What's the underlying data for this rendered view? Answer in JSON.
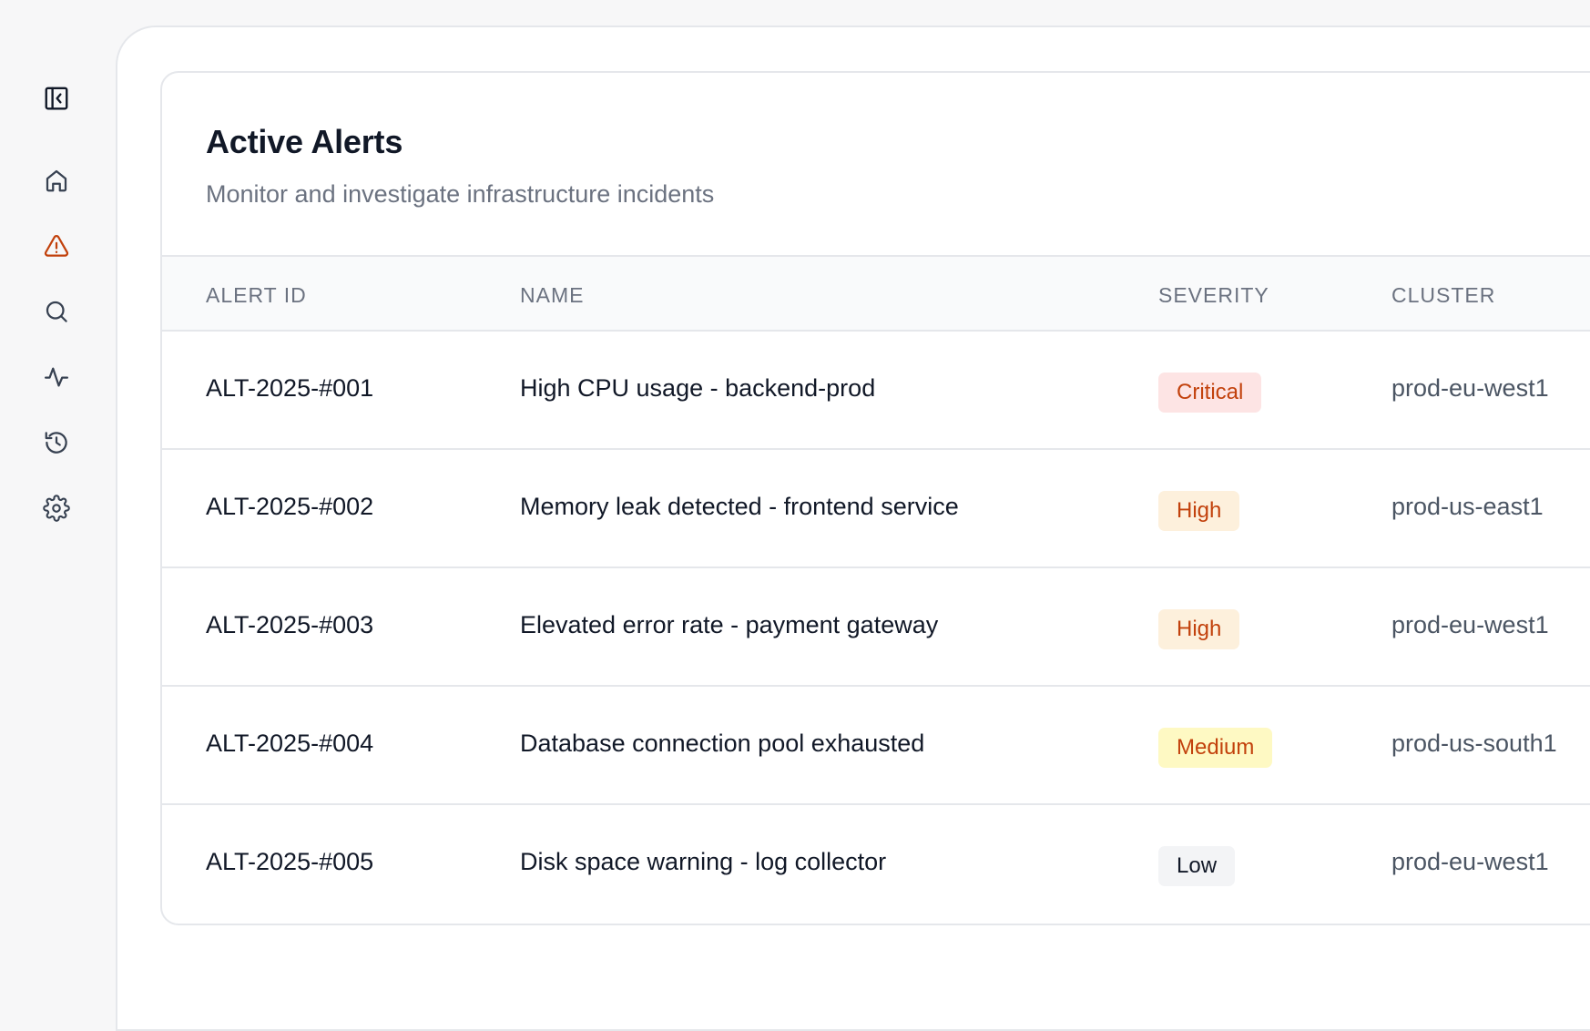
{
  "sidebar": {
    "items": [
      {
        "icon": "collapse-sidebar-icon",
        "active": false
      },
      {
        "icon": "home-icon",
        "active": false
      },
      {
        "icon": "alert-triangle-icon",
        "active": true
      },
      {
        "icon": "search-icon",
        "active": false
      },
      {
        "icon": "activity-icon",
        "active": false
      },
      {
        "icon": "history-icon",
        "active": false
      },
      {
        "icon": "settings-icon",
        "active": false
      }
    ],
    "icon_color": "#374151",
    "active_color": "#c2410c"
  },
  "alerts_panel": {
    "title": "Active Alerts",
    "subtitle": "Monitor and investigate infrastructure incidents",
    "columns": [
      "ALERT ID",
      "NAME",
      "SEVERITY",
      "CLUSTER"
    ],
    "rows": [
      {
        "id": "ALT-2025-#001",
        "name": "High CPU usage - backend-prod",
        "severity": "Critical",
        "cluster": "prod-eu-west1"
      },
      {
        "id": "ALT-2025-#002",
        "name": "Memory leak detected - frontend service",
        "severity": "High",
        "cluster": "prod-us-east1"
      },
      {
        "id": "ALT-2025-#003",
        "name": "Elevated error rate - payment gateway",
        "severity": "High",
        "cluster": "prod-eu-west1"
      },
      {
        "id": "ALT-2025-#004",
        "name": "Database connection pool exhausted",
        "severity": "Medium",
        "cluster": "prod-us-south1"
      },
      {
        "id": "ALT-2025-#005",
        "name": "Disk space warning - log collector",
        "severity": "Low",
        "cluster": "prod-eu-west1"
      }
    ]
  },
  "severity_colors": {
    "Critical": {
      "bg": "#fde4e4",
      "fg": "#c2410c"
    },
    "High": {
      "bg": "#fdf0dc",
      "fg": "#c2410c"
    },
    "Medium": {
      "bg": "#fef9c3",
      "fg": "#c2410c"
    },
    "Low": {
      "bg": "#f3f4f6",
      "fg": "#111827"
    }
  }
}
